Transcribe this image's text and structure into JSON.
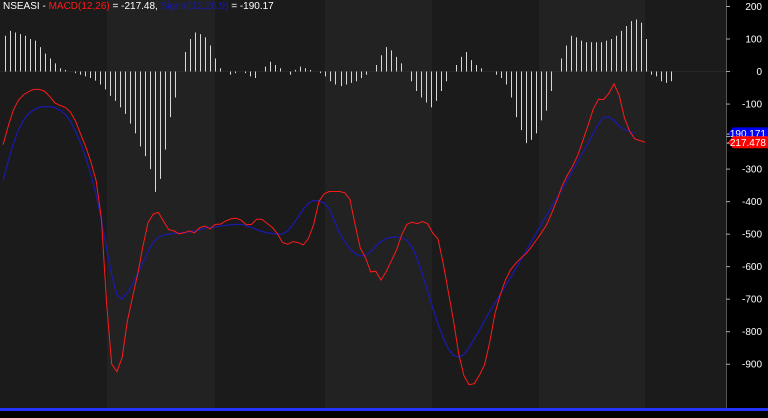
{
  "title": {
    "symbol": "NSEASI",
    "sep1": " - ",
    "macd_label": "MACD(12,26)",
    "macd_value": " = -217.48,",
    "signal_label": "Signal(12,26,9)",
    "signal_value": " = -190.17"
  },
  "colors": {
    "background": "#000000",
    "band_dark": "#1b1b1b",
    "band_light": "#222222",
    "macd": "#ff1a1a",
    "signal": "#1a1aa8",
    "histogram": "#d8d8d8",
    "axis_text": "#ffffff",
    "signal_tag": "#0000ff",
    "macd_tag": "#ff0000",
    "bottom_bar": "#2233ff"
  },
  "value_tags": {
    "signal": "-190.171",
    "macd": "-217.478"
  },
  "chart_data": {
    "type": "line",
    "ylim": [
      -1010,
      220
    ],
    "yticks": [
      200,
      100,
      0,
      -100,
      -200,
      -300,
      -400,
      -500,
      -600,
      -700,
      -800,
      -900
    ],
    "x_points": 130,
    "series": [
      {
        "name": "MACD(12,26)",
        "kind": "line",
        "values": [
          -225,
          -168,
          -118,
          -88,
          -71,
          -61,
          -55,
          -55,
          -60,
          -76,
          -96,
          -104,
          -110,
          -124,
          -152,
          -193,
          -232,
          -279,
          -337,
          -452,
          -713,
          -900,
          -923,
          -880,
          -768,
          -694,
          -624,
          -539,
          -465,
          -438,
          -433,
          -460,
          -486,
          -490,
          -499,
          -496,
          -490,
          -496,
          -480,
          -475,
          -484,
          -470,
          -469,
          -460,
          -453,
          -451,
          -457,
          -471,
          -470,
          -454,
          -454,
          -467,
          -479,
          -499,
          -526,
          -531,
          -523,
          -526,
          -533,
          -513,
          -470,
          -400,
          -376,
          -369,
          -369,
          -369,
          -373,
          -393,
          -471,
          -543,
          -572,
          -616,
          -614,
          -641,
          -615,
          -582,
          -548,
          -502,
          -470,
          -463,
          -468,
          -461,
          -468,
          -497,
          -515,
          -590,
          -677,
          -766,
          -868,
          -935,
          -963,
          -960,
          -934,
          -901,
          -831,
          -745,
          -688,
          -642,
          -610,
          -590,
          -574,
          -560,
          -540,
          -518,
          -496,
          -471,
          -434,
          -394,
          -350,
          -318,
          -291,
          -257,
          -211,
          -165,
          -115,
          -85,
          -86,
          -67,
          -38,
          -73,
          -142,
          -183,
          -207,
          -212,
          -217.48
        ]
      },
      {
        "name": "Signal(12,26,9)",
        "kind": "line",
        "values": [
          -335,
          -276,
          -222,
          -178,
          -149,
          -128,
          -117,
          -110,
          -108,
          -108,
          -111,
          -119,
          -131,
          -152,
          -184,
          -221,
          -266,
          -318,
          -380,
          -457,
          -545,
          -625,
          -686,
          -700,
          -680,
          -653,
          -622,
          -588,
          -553,
          -525,
          -510,
          -503,
          -500,
          -498,
          -497,
          -495,
          -493,
          -491,
          -486,
          -481,
          -480,
          -478,
          -475,
          -473,
          -471,
          -470,
          -470,
          -474,
          -480,
          -486,
          -492,
          -496,
          -498,
          -500,
          -500,
          -490,
          -470,
          -447,
          -423,
          -405,
          -396,
          -398,
          -404,
          -422,
          -459,
          -497,
          -524,
          -545,
          -560,
          -567,
          -565,
          -553,
          -537,
          -523,
          -514,
          -509,
          -509,
          -511,
          -519,
          -540,
          -576,
          -623,
          -676,
          -727,
          -776,
          -818,
          -853,
          -873,
          -878,
          -870,
          -849,
          -822,
          -795,
          -766,
          -738,
          -712,
          -686,
          -660,
          -633,
          -607,
          -580,
          -552,
          -524,
          -496,
          -468,
          -441,
          -415,
          -388,
          -360,
          -332,
          -304,
          -276,
          -248,
          -220,
          -190,
          -160,
          -141,
          -140,
          -150,
          -167,
          -178,
          -185,
          -190.17
        ]
      },
      {
        "name": "Histogram",
        "kind": "bar",
        "values": [
          110,
          125,
          120,
          115,
          110,
          100,
          95,
          75,
          55,
          40,
          25,
          10,
          5,
          0,
          -5,
          -10,
          -15,
          -20,
          -28,
          -40,
          -55,
          -75,
          -90,
          -110,
          -130,
          -160,
          -190,
          -230,
          -260,
          -300,
          -370,
          -330,
          -240,
          -140,
          -80,
          0,
          60,
          100,
          120,
          115,
          105,
          80,
          40,
          10,
          0,
          -10,
          -5,
          0,
          -5,
          -15,
          -20,
          0,
          15,
          30,
          20,
          10,
          0,
          -10,
          5,
          15,
          10,
          5,
          0,
          -5,
          -15,
          -30,
          -40,
          -45,
          -40,
          -35,
          -30,
          -20,
          -10,
          0,
          20,
          50,
          75,
          65,
          45,
          25,
          0,
          -30,
          -60,
          -80,
          -95,
          -110,
          -90,
          -60,
          -30,
          0,
          20,
          45,
          60,
          35,
          20,
          10,
          0,
          0,
          -10,
          -20,
          -40,
          -80,
          -140,
          -180,
          -220,
          -210,
          -190,
          -150,
          -120,
          -60,
          0,
          40,
          80,
          110,
          105,
          95,
          90,
          90,
          90,
          90,
          95,
          100,
          110,
          125,
          140,
          155,
          160,
          150,
          100,
          -10,
          -15,
          -30,
          -35,
          -30
        ]
      }
    ]
  }
}
